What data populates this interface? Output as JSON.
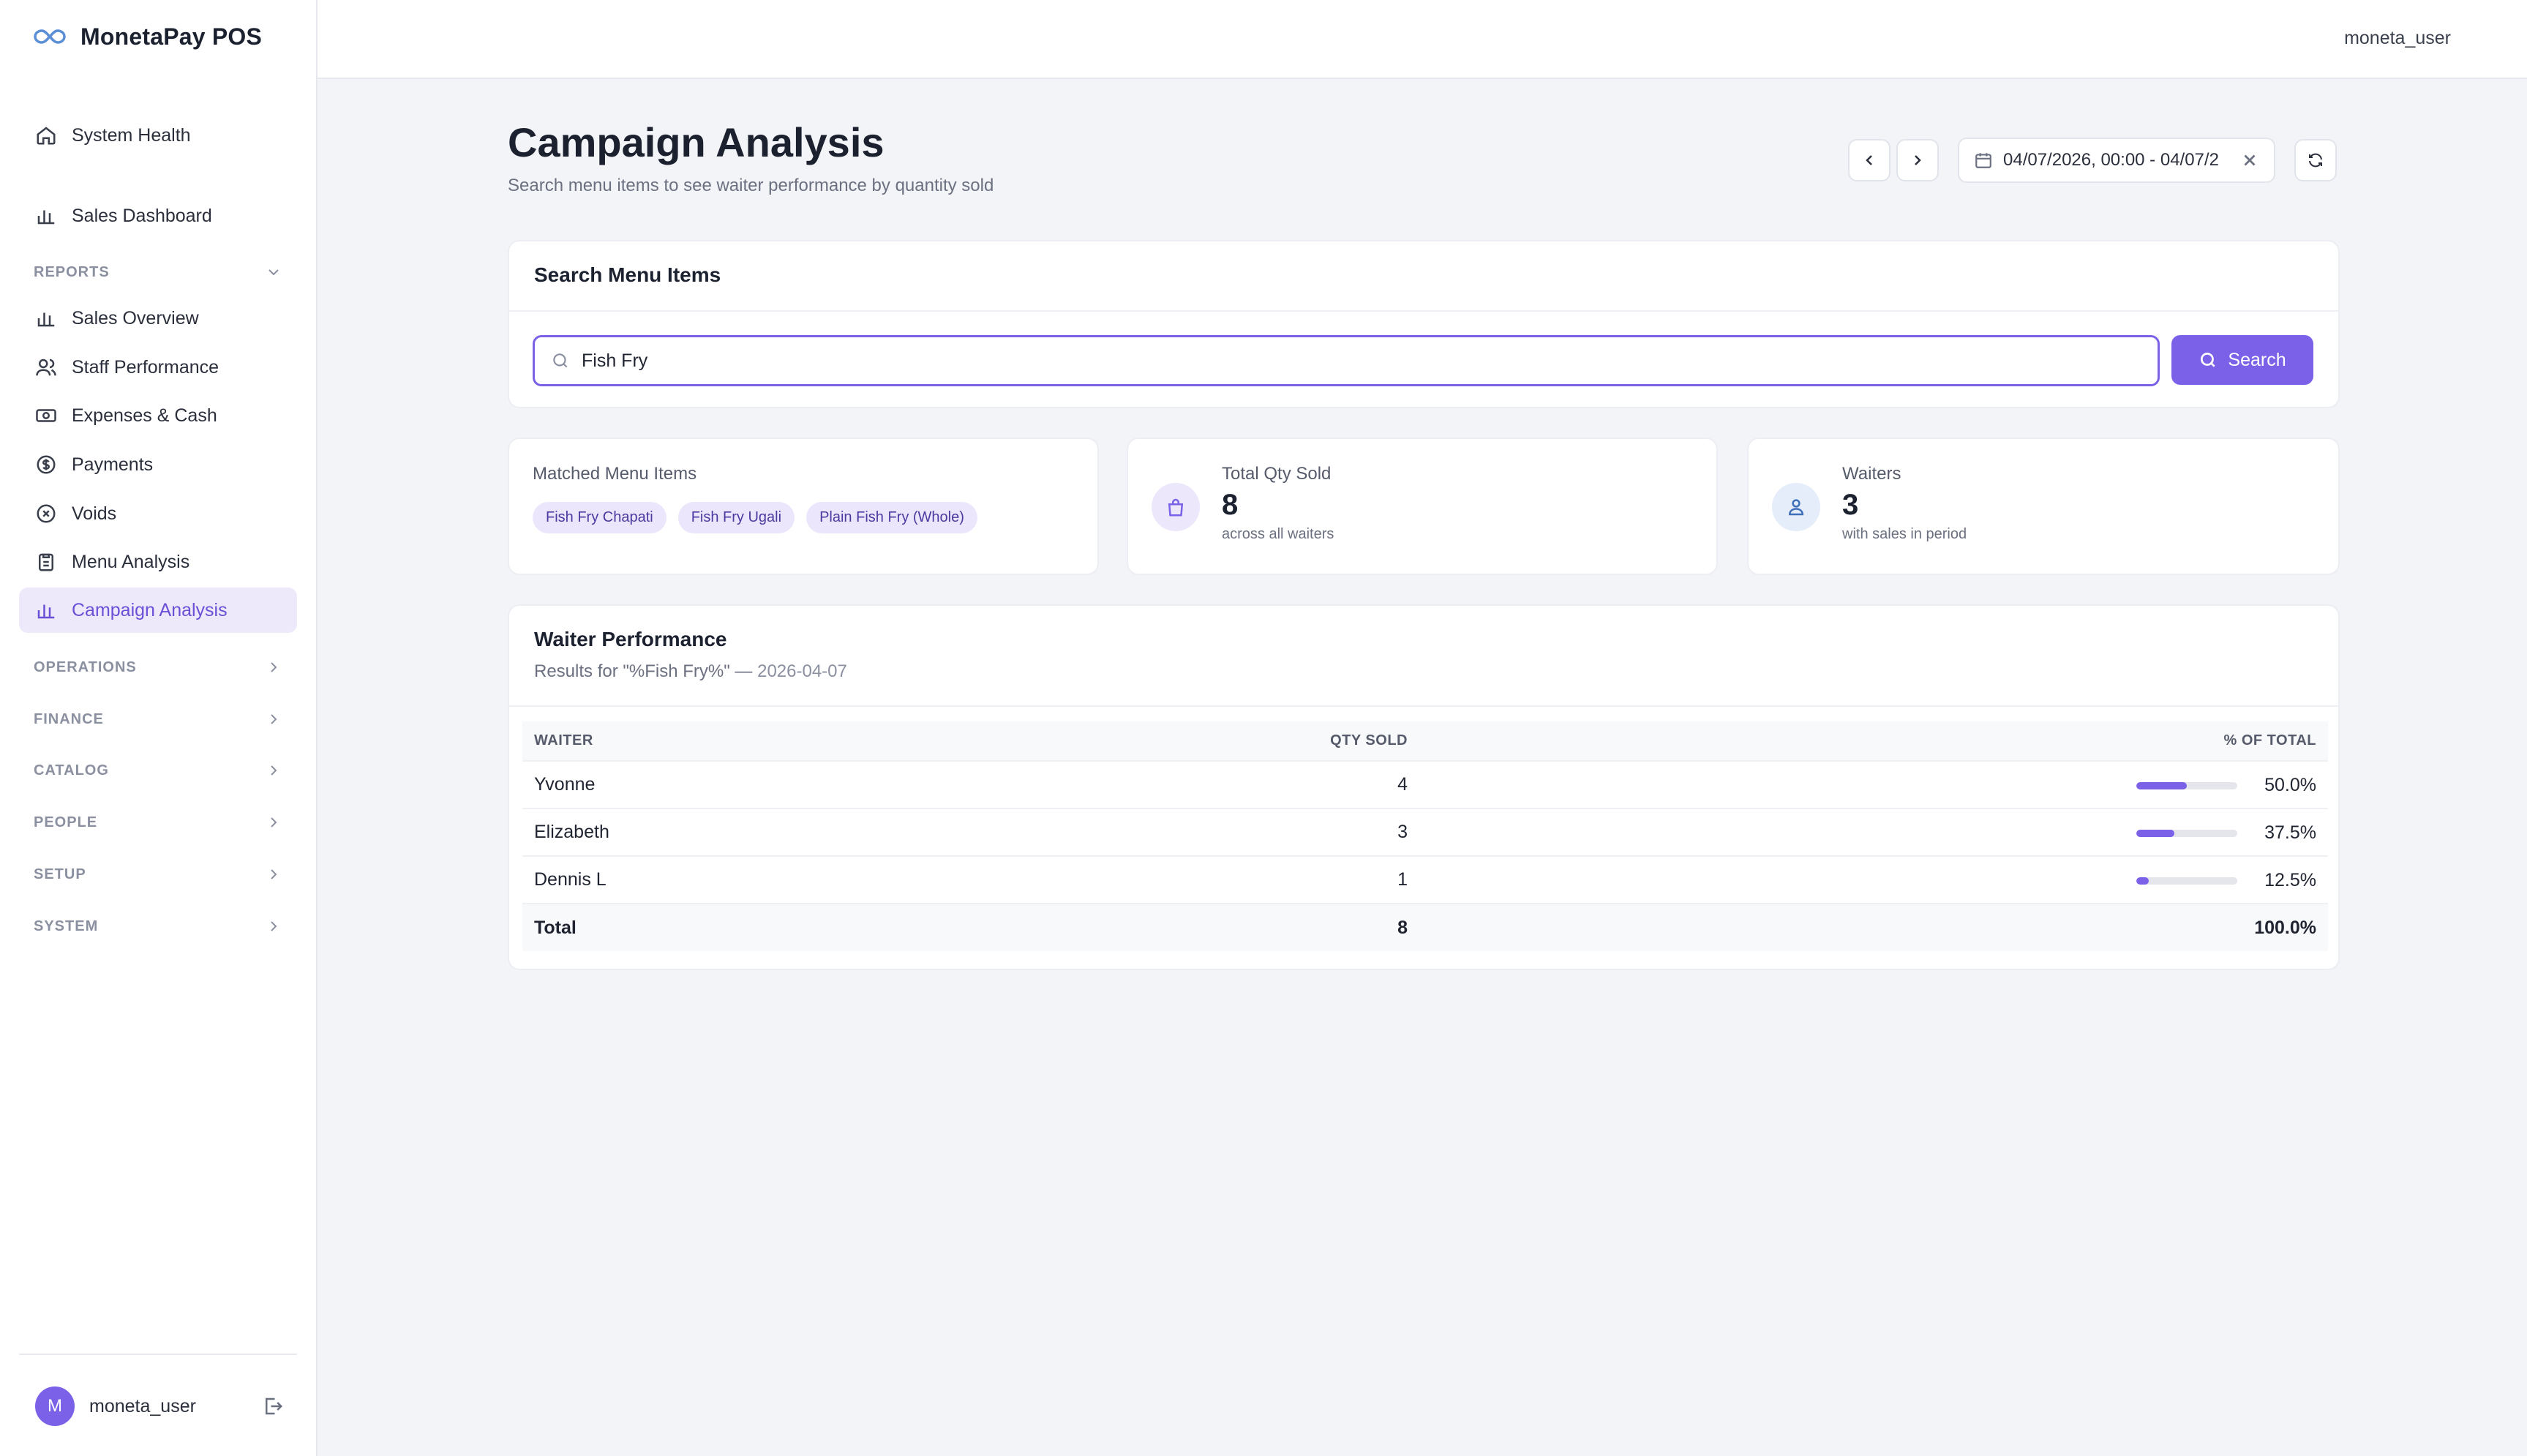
{
  "app": {
    "name": "MonetaPay POS",
    "accent": "#7b61e8"
  },
  "sidebar": {
    "top_items": [
      {
        "label": "System Health",
        "icon": "home-icon"
      },
      {
        "label": "Sales Dashboard",
        "icon": "bar-chart-icon"
      }
    ],
    "reports_section": "REPORTS",
    "report_items": [
      {
        "label": "Sales Overview",
        "icon": "bar-chart-icon"
      },
      {
        "label": "Staff Performance",
        "icon": "users-icon"
      },
      {
        "label": "Expenses & Cash",
        "icon": "cash-icon"
      },
      {
        "label": "Payments",
        "icon": "dollar-circle-icon"
      },
      {
        "label": "Voids",
        "icon": "x-circle-icon"
      },
      {
        "label": "Menu Analysis",
        "icon": "clipboard-icon"
      },
      {
        "label": "Campaign Analysis",
        "icon": "bar-chart-icon",
        "active": true
      }
    ],
    "sections": [
      "OPERATIONS",
      "FINANCE",
      "CATALOG",
      "PEOPLE",
      "SETUP",
      "SYSTEM"
    ],
    "user": {
      "initial": "M",
      "name": "moneta_user"
    }
  },
  "topbar": {
    "user": "moneta_user"
  },
  "page": {
    "title": "Campaign Analysis",
    "subtitle": "Search menu items to see waiter performance by quantity sold",
    "date_range": "04/07/2026, 00:00 - 04/07/2"
  },
  "search": {
    "title": "Search Menu Items",
    "value": "Fish Fry",
    "button": "Search"
  },
  "stats": {
    "matched": {
      "label": "Matched Menu Items",
      "chips": [
        "Fish Fry Chapati",
        "Fish Fry Ugali",
        "Plain Fish Fry (Whole)"
      ]
    },
    "qty": {
      "label": "Total Qty Sold",
      "value": "8",
      "note": "across all waiters"
    },
    "waiters": {
      "label": "Waiters",
      "value": "3",
      "note": "with sales in period"
    }
  },
  "performance": {
    "title": "Waiter Performance",
    "results_prefix": "Results for \"%Fish Fry%\" — ",
    "results_date": "2026-04-07",
    "columns": [
      "WAITER",
      "QTY SOLD",
      "% OF TOTAL"
    ],
    "rows": [
      {
        "waiter": "Yvonne",
        "qty": "4",
        "pct": "50.0%",
        "share": 0.5
      },
      {
        "waiter": "Elizabeth",
        "qty": "3",
        "pct": "37.5%",
        "share": 0.375
      },
      {
        "waiter": "Dennis L",
        "qty": "1",
        "pct": "12.5%",
        "share": 0.125
      }
    ],
    "total": {
      "label": "Total",
      "qty": "8",
      "pct": "100.0%"
    }
  }
}
